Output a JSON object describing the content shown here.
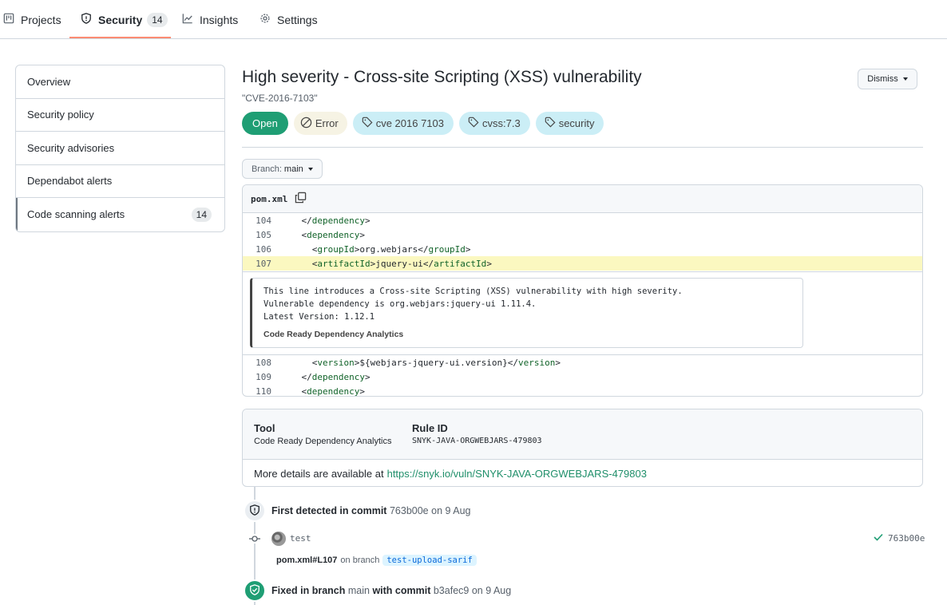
{
  "nav": {
    "tabs": [
      {
        "label": "Projects",
        "icon": "project-icon"
      },
      {
        "label": "Security",
        "icon": "shield-icon",
        "count": "14"
      },
      {
        "label": "Insights",
        "icon": "graph-icon"
      },
      {
        "label": "Settings",
        "icon": "gear-icon"
      }
    ],
    "active": "Security",
    "accent": "#fd8c73"
  },
  "sidebar": {
    "items": [
      {
        "label": "Overview"
      },
      {
        "label": "Security policy"
      },
      {
        "label": "Security advisories"
      },
      {
        "label": "Dependabot alerts"
      },
      {
        "label": "Code scanning alerts",
        "count": "14"
      }
    ],
    "selected": "Code scanning alerts"
  },
  "alert": {
    "title": "High severity - Cross-site Scripting (XSS) vulnerability",
    "cve": "\"CVE-2016-7103\"",
    "dismiss_label": "Dismiss",
    "labels": {
      "open": "Open",
      "error": "Error",
      "tags": [
        "cve 2016 7103",
        "cvss:7.3",
        "security"
      ]
    },
    "colors": {
      "open": "#1f9e74",
      "tag": "#cbeef6",
      "error_bg": "#f6f3e4"
    }
  },
  "branch": {
    "prefix": "Branch:",
    "name": "main"
  },
  "code": {
    "filename": "pom.xml",
    "lines_before": [
      {
        "n": "104",
        "indent": "    ",
        "open": "</",
        "tag": "dependency",
        "close": ">",
        "text": "",
        "end_open": "",
        "end_tag": "",
        "end_close": ""
      },
      {
        "n": "105",
        "indent": "    ",
        "open": "<",
        "tag": "dependency",
        "close": ">",
        "text": "",
        "end_open": "",
        "end_tag": "",
        "end_close": ""
      },
      {
        "n": "106",
        "indent": "      ",
        "open": "<",
        "tag": "groupId",
        "close": ">",
        "text": "org.webjars",
        "end_open": "</",
        "end_tag": "groupId",
        "end_close": ">"
      },
      {
        "n": "107",
        "indent": "      ",
        "open": "<",
        "tag": "artifactId",
        "close": ">",
        "text": "jquery-ui",
        "end_open": "</",
        "end_tag": "artifactId",
        "end_close": ">"
      }
    ],
    "highlight_line": "107",
    "message": "This line introduces a Cross-site Scripting (XSS) vulnerability with high severity.\nVulnerable dependency is org.webjars:jquery-ui 1.11.4.\nLatest Version: 1.12.1",
    "message_source": "Code Ready Dependency Analytics",
    "lines_after": [
      {
        "n": "108",
        "indent": "      ",
        "open": "<",
        "tag": "version",
        "close": ">",
        "text": "${webjars-jquery-ui.version}",
        "end_open": "</",
        "end_tag": "version",
        "end_close": ">"
      },
      {
        "n": "109",
        "indent": "    ",
        "open": "</",
        "tag": "dependency",
        "close": ">",
        "text": "",
        "end_open": "",
        "end_tag": "",
        "end_close": ""
      },
      {
        "n": "110",
        "indent": "    ",
        "open": "<",
        "tag": "dependency",
        "close": ">",
        "text": "",
        "end_open": "",
        "end_tag": "",
        "end_close": ""
      }
    ]
  },
  "tool": {
    "tool_header": "Tool",
    "tool_value": "Code Ready Dependency Analytics",
    "rule_header": "Rule ID",
    "rule_value": "SNYK-JAVA-ORGWEBJARS-479803",
    "more_prefix": "More details are available at",
    "more_link": "https://snyk.io/vuln/SNYK-JAVA-ORGWEBJARS-479803"
  },
  "timeline": {
    "detected": {
      "bold": "First detected in commit",
      "sha": "763b00e",
      "on": "on",
      "date": "9 Aug"
    },
    "commit": {
      "message": "test",
      "sha": "763b00e"
    },
    "location": {
      "file": "pom.xml#L107",
      "on_branch": "on branch",
      "branch": "test-upload-sarif"
    },
    "fixed": {
      "bold1": "Fixed in branch",
      "branch": "main",
      "bold2": "with commit",
      "sha": "b3afec9",
      "on": "on",
      "date": "9 Aug"
    }
  }
}
